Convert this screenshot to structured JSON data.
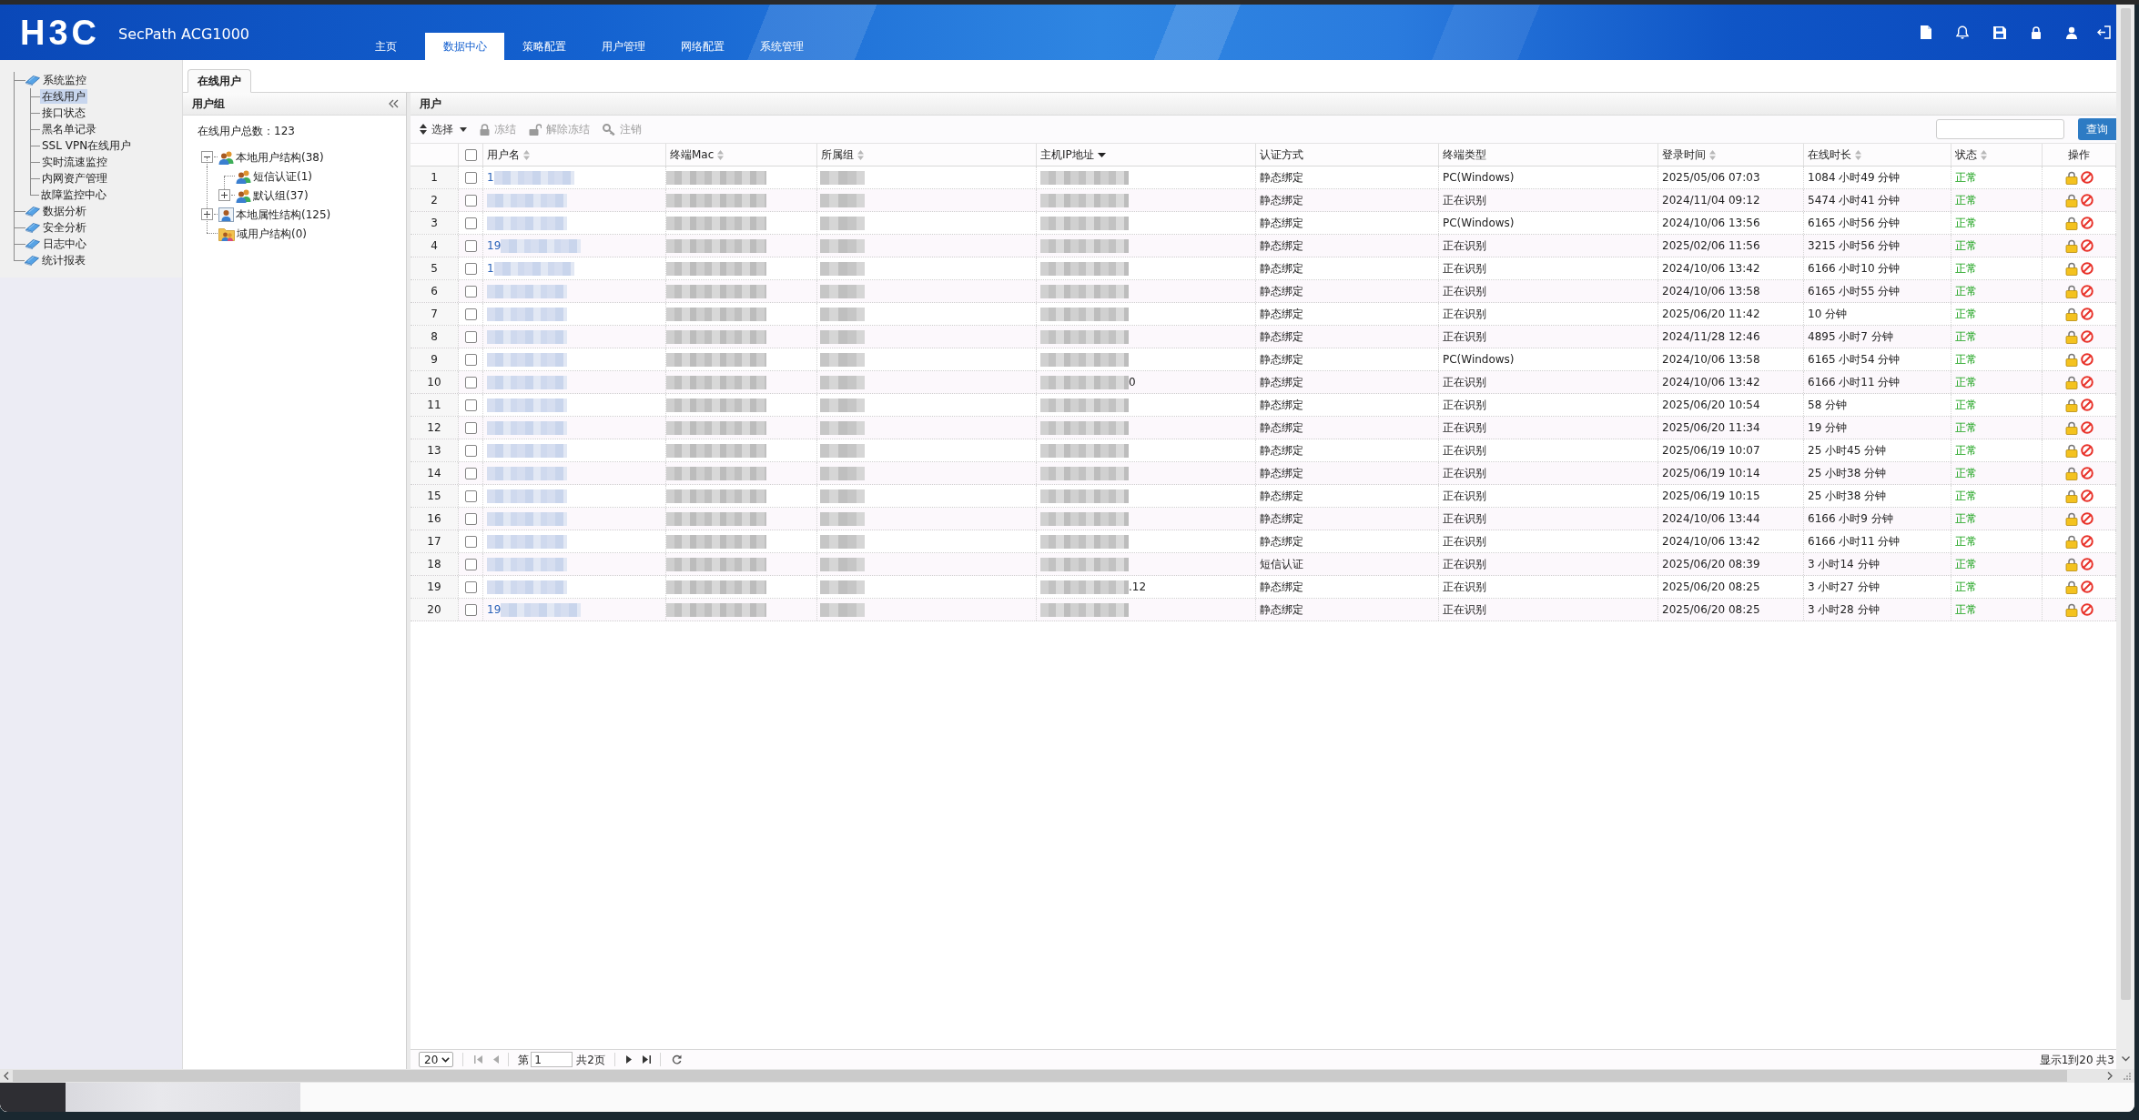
{
  "header": {
    "logo": "H3C",
    "product": "SecPath ACG1000",
    "nav": [
      {
        "label": "主页",
        "selected": false
      },
      {
        "label": "数据中心",
        "selected": true
      },
      {
        "label": "策略配置",
        "selected": false
      },
      {
        "label": "用户管理",
        "selected": false
      },
      {
        "label": "网络配置",
        "selected": false
      },
      {
        "label": "系统管理",
        "selected": false
      }
    ]
  },
  "sidebar": {
    "items": [
      {
        "label": "系统监控",
        "selected": false,
        "children": [
          {
            "label": "在线用户",
            "selected": true
          },
          {
            "label": "接口状态",
            "selected": false
          },
          {
            "label": "黑名单记录",
            "selected": false
          },
          {
            "label": "SSL VPN在线用户",
            "selected": false
          },
          {
            "label": "实时流速监控",
            "selected": false
          },
          {
            "label": "内网资产管理",
            "selected": false
          },
          {
            "label": "故障监控中心",
            "selected": false
          }
        ]
      },
      {
        "label": "数据分析",
        "selected": false
      },
      {
        "label": "安全分析",
        "selected": false
      },
      {
        "label": "日志中心",
        "selected": false
      },
      {
        "label": "统计报表",
        "selected": false
      }
    ]
  },
  "page_tabs": [
    {
      "label": "在线用户",
      "selected": true
    }
  ],
  "group_panel": {
    "title": "用户组",
    "total": "在线用户总数：123",
    "tree": [
      {
        "label": "本地用户结构(38)",
        "kind": "group",
        "expandable": true,
        "expanded": true,
        "children": [
          {
            "label": "短信认证(1)",
            "kind": "group",
            "expandable": false
          },
          {
            "label": "默认组(37)",
            "kind": "group",
            "expandable": true,
            "expanded": false
          }
        ]
      },
      {
        "label": "本地属性结构(125)",
        "kind": "attribute",
        "expandable": true,
        "expanded": false
      },
      {
        "label": "域用户结构(0)",
        "kind": "domain",
        "expandable": false
      }
    ]
  },
  "user_panel": {
    "title": "用户",
    "toolbar": [
      {
        "label": "选择",
        "kind": "select",
        "disabled": false
      },
      {
        "label": "冻结",
        "kind": "lock",
        "disabled": true
      },
      {
        "label": "解除冻结",
        "kind": "unlock",
        "disabled": true
      },
      {
        "label": "注销",
        "kind": "key",
        "disabled": true
      }
    ],
    "search_button": "查询",
    "table": {
      "header_checked": false,
      "columns": [
        {
          "label": "用户名",
          "kind": "sortable"
        },
        {
          "label": "终端Mac",
          "kind": "sortable"
        },
        {
          "label": "所属组",
          "kind": "sortable"
        },
        {
          "label": "主机IP地址",
          "kind": "sorted"
        },
        {
          "label": "认证方式",
          "kind": "plain"
        },
        {
          "label": "终端类型",
          "kind": "plain"
        },
        {
          "label": "登录时间",
          "kind": "sortable"
        },
        {
          "label": "在线时长",
          "kind": "sortable"
        },
        {
          "label": "状态",
          "kind": "sortable"
        },
        {
          "label": "操作",
          "kind": "plain"
        }
      ],
      "rows": [
        {
          "index": "1",
          "checked": false,
          "user_fragment": "1",
          "auth": "静态绑定",
          "terminal": "PC(Windows)",
          "login": "2025/05/06 07:03",
          "duration": "1084 小时49 分钟",
          "status": "正常"
        },
        {
          "index": "2",
          "checked": false,
          "auth": "静态绑定",
          "terminal": "正在识别",
          "login": "2024/11/04 09:12",
          "duration": "5474 小时41 分钟",
          "status": "正常"
        },
        {
          "index": "3",
          "checked": false,
          "auth": "静态绑定",
          "terminal": "PC(Windows)",
          "login": "2024/10/06 13:56",
          "duration": "6165 小时56 分钟",
          "status": "正常"
        },
        {
          "index": "4",
          "checked": false,
          "user_fragment": "19",
          "auth": "静态绑定",
          "terminal": "正在识别",
          "login": "2025/02/06 11:56",
          "duration": "3215 小时56 分钟",
          "status": "正常"
        },
        {
          "index": "5",
          "checked": false,
          "user_fragment": "1",
          "auth": "静态绑定",
          "terminal": "正在识别",
          "login": "2024/10/06 13:42",
          "duration": "6166 小时10 分钟",
          "status": "正常"
        },
        {
          "index": "6",
          "checked": false,
          "auth": "静态绑定",
          "terminal": "正在识别",
          "login": "2024/10/06 13:58",
          "duration": "6165 小时55 分钟",
          "status": "正常"
        },
        {
          "index": "7",
          "checked": false,
          "auth": "静态绑定",
          "terminal": "正在识别",
          "login": "2025/06/20 11:42",
          "duration": "10 分钟",
          "status": "正常"
        },
        {
          "index": "8",
          "checked": false,
          "auth": "静态绑定",
          "terminal": "正在识别",
          "login": "2024/11/28 12:46",
          "duration": "4895 小时7 分钟",
          "status": "正常"
        },
        {
          "index": "9",
          "checked": false,
          "auth": "静态绑定",
          "terminal": "PC(Windows)",
          "login": "2024/10/06 13:58",
          "duration": "6165 小时54 分钟",
          "status": "正常"
        },
        {
          "index": "10",
          "checked": false,
          "ip_fragment": "0",
          "auth": "静态绑定",
          "terminal": "正在识别",
          "login": "2024/10/06 13:42",
          "duration": "6166 小时11 分钟",
          "status": "正常"
        },
        {
          "index": "11",
          "checked": false,
          "auth": "静态绑定",
          "terminal": "正在识别",
          "login": "2025/06/20 10:54",
          "duration": "58 分钟",
          "status": "正常"
        },
        {
          "index": "12",
          "checked": false,
          "auth": "静态绑定",
          "terminal": "正在识别",
          "login": "2025/06/20 11:34",
          "duration": "19 分钟",
          "status": "正常"
        },
        {
          "index": "13",
          "checked": false,
          "auth": "静态绑定",
          "terminal": "正在识别",
          "login": "2025/06/19 10:07",
          "duration": "25 小时45 分钟",
          "status": "正常"
        },
        {
          "index": "14",
          "checked": false,
          "auth": "静态绑定",
          "terminal": "正在识别",
          "login": "2025/06/19 10:14",
          "duration": "25 小时38 分钟",
          "status": "正常"
        },
        {
          "index": "15",
          "checked": false,
          "auth": "静态绑定",
          "terminal": "正在识别",
          "login": "2025/06/19 10:15",
          "duration": "25 小时38 分钟",
          "status": "正常"
        },
        {
          "index": "16",
          "checked": false,
          "auth": "静态绑定",
          "terminal": "正在识别",
          "login": "2024/10/06 13:44",
          "duration": "6166 小时9 分钟",
          "status": "正常"
        },
        {
          "index": "17",
          "checked": false,
          "auth": "静态绑定",
          "terminal": "正在识别",
          "login": "2024/10/06 13:42",
          "duration": "6166 小时11 分钟",
          "status": "正常"
        },
        {
          "index": "18",
          "checked": false,
          "auth": "短信认证",
          "terminal": "正在识别",
          "login": "2025/06/20 08:39",
          "duration": "3 小时14 分钟",
          "status": "正常"
        },
        {
          "index": "19",
          "checked": false,
          "ip_fragment": ".12",
          "auth": "静态绑定",
          "terminal": "正在识别",
          "login": "2025/06/20 08:25",
          "duration": "3 小时27 分钟",
          "status": "正常"
        },
        {
          "index": "20",
          "checked": false,
          "user_fragment": "19",
          "auth": "静态绑定",
          "terminal": "正在识别",
          "login": "2025/06/20 08:25",
          "duration": "3 小时28 分钟",
          "status": "正常"
        }
      ]
    },
    "pagination": {
      "page_size": "20",
      "page_prefix": "第",
      "page": "1",
      "page_total": "共2页",
      "summary": "显示1到20 共3"
    }
  }
}
